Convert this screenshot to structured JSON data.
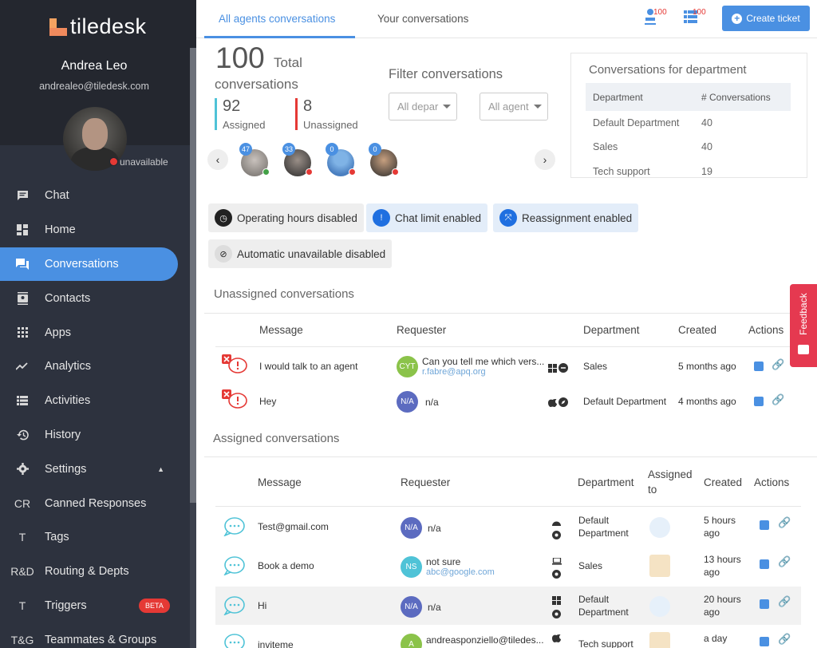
{
  "sidebar": {
    "logo_text": "tiledesk",
    "user_name": "Andrea Leo",
    "user_email": "andrealeo@tiledesk.com",
    "availability": "unavailable",
    "items": [
      {
        "label": "Chat",
        "icon": "chat-icon"
      },
      {
        "label": "Home",
        "icon": "home-icon"
      },
      {
        "label": "Conversations",
        "icon": "conversations-icon",
        "active": true
      },
      {
        "label": "Contacts",
        "icon": "contacts-icon"
      },
      {
        "label": "Apps",
        "icon": "apps-icon"
      },
      {
        "label": "Analytics",
        "icon": "analytics-icon"
      },
      {
        "label": "Activities",
        "icon": "activities-icon"
      },
      {
        "label": "History",
        "icon": "history-icon"
      },
      {
        "label": "Settings",
        "icon": "gear-icon"
      },
      {
        "label": "Canned Responses",
        "abbr": "CR"
      },
      {
        "label": "Tags",
        "abbr": "T"
      },
      {
        "label": "Routing & Depts",
        "abbr": "R&D"
      },
      {
        "label": "Triggers",
        "abbr": "T",
        "badge": "BETA"
      },
      {
        "label": "Teammates & Groups",
        "abbr": "T&G"
      }
    ]
  },
  "header": {
    "tab_all": "All agents conversations",
    "tab_yours": "Your conversations",
    "count_unserved": "100",
    "count_queue": "100",
    "create_ticket": "Create ticket"
  },
  "summary": {
    "total": "100",
    "total_label_1": "Total",
    "total_label_2": "conversations",
    "assigned": "92",
    "assigned_label": "Assigned",
    "unassigned": "8",
    "unassigned_label": "Unassigned"
  },
  "filters": {
    "title": "Filter conversations",
    "department": "All depar",
    "agent": "All agent"
  },
  "agents": [
    {
      "count": "47",
      "status": "available"
    },
    {
      "count": "33",
      "status": "unavailable"
    },
    {
      "count": "0",
      "status": "unavailable"
    },
    {
      "count": "0",
      "status": "unavailable"
    }
  ],
  "departments_card": {
    "title": "Conversations for department",
    "col_department": "Department",
    "col_conversations": "# Conversations",
    "rows": [
      {
        "name": "Default Department",
        "count": "40"
      },
      {
        "name": "Sales",
        "count": "40"
      },
      {
        "name": "Tech support",
        "count": "19"
      }
    ]
  },
  "chips": {
    "operating_hours": "Operating hours disabled",
    "chat_limit": "Chat limit enabled",
    "reassignment": "Reassignment enabled",
    "auto_unavailable": "Automatic unavailable disabled"
  },
  "unassigned": {
    "title": "Unassigned conversations",
    "headers": {
      "message": "Message",
      "requester": "Requester",
      "department": "Department",
      "created": "Created",
      "actions": "Actions"
    },
    "rows": [
      {
        "message": "I would talk to an agent",
        "initials": "CYT",
        "avatar_color": "#8bc34a",
        "req_name": "Can you tell me which vers...",
        "req_email": "r.fabre@apq.org",
        "department": "Sales",
        "created": "5 months ago"
      },
      {
        "message": "Hey",
        "initials": "N/A",
        "avatar_color": "#5c6bc0",
        "req_name": "n/a",
        "req_email": "",
        "department": "Default Department",
        "created": "4 months ago"
      }
    ]
  },
  "assigned": {
    "title": "Assigned conversations",
    "headers": {
      "message": "Message",
      "requester": "Requester",
      "department": "Department",
      "assigned_1": "Assigned",
      "assigned_2": "to",
      "created": "Created",
      "actions": "Actions"
    },
    "rows": [
      {
        "message": "Test@gmail.com",
        "initials": "N/A",
        "avatar_color": "#5c6bc0",
        "req_name": "n/a",
        "req_email": "",
        "dept_1": "Default",
        "dept_2": "Department",
        "created_1": "5 hours",
        "created_2": "ago"
      },
      {
        "message": "Book a demo",
        "initials": "NS",
        "avatar_color": "#4fc3d7",
        "req_name": "not sure",
        "req_email": "abc@google.com",
        "dept_1": "Sales",
        "dept_2": "",
        "created_1": "13 hours",
        "created_2": "ago"
      },
      {
        "message": "Hi",
        "initials": "N/A",
        "avatar_color": "#5c6bc0",
        "req_name": "n/a",
        "req_email": "",
        "dept_1": "Default",
        "dept_2": "Department",
        "created_1": "20 hours",
        "created_2": "ago"
      },
      {
        "message": "inviteme",
        "initials": "A",
        "avatar_color": "#8bc34a",
        "req_name": "andreasponziello@tiledes...",
        "req_email": "",
        "dept_1": "Tech support",
        "dept_2": "",
        "created_1": "a day",
        "created_2": ""
      }
    ]
  },
  "feedback": "Feedback"
}
